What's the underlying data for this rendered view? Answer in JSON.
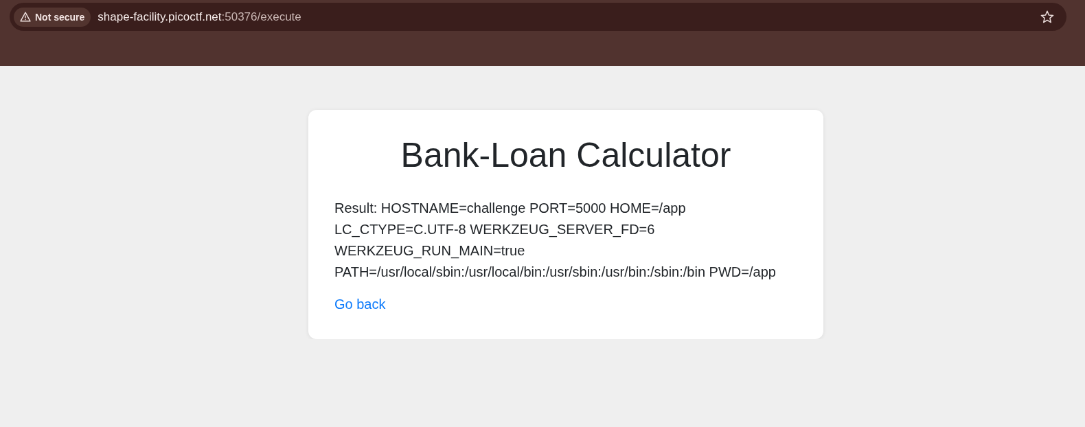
{
  "browser": {
    "security_chip": {
      "label": "Not secure"
    },
    "url": {
      "host": "shape-facility.picoctf.net",
      "path": ":50376/execute"
    }
  },
  "page": {
    "title": "Bank-Loan Calculator",
    "result": "Result: HOSTNAME=challenge PORT=5000 HOME=/app LC_CTYPE=C.UTF-8 WERKZEUG_SERVER_FD=6 WERKZEUG_RUN_MAIN=true PATH=/usr/local/sbin:/usr/local/bin:/usr/sbin:/usr/bin:/sbin:/bin PWD=/app",
    "link": "Go back"
  }
}
